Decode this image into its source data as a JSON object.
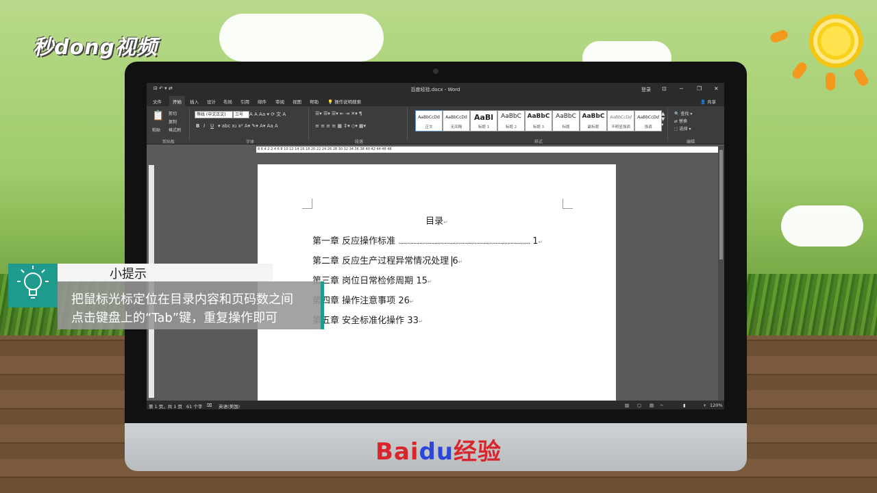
{
  "watermark": "秒dong视频",
  "brand": {
    "prefix": "Bai",
    "paw": "du",
    "suffix": "经验"
  },
  "word": {
    "quick_access": "⊟ ↶ ▾ ⇄",
    "doc_title": "百度经验.docx - Word",
    "login": "登录",
    "share": "共享",
    "tabs": [
      "文件",
      "开始",
      "插入",
      "设计",
      "布局",
      "引用",
      "邮件",
      "审阅",
      "视图",
      "帮助"
    ],
    "active_tab": "开始",
    "tell_me": "操作说明搜索",
    "clipboard": {
      "paste": "粘贴",
      "cut": "剪切",
      "copy": "复制",
      "format_painter": "格式刷",
      "label": "剪贴板"
    },
    "font": {
      "name": "等线 (中文正文)",
      "size": "三号",
      "bold": "B",
      "italic": "I",
      "underline": "U",
      "label": "字体"
    },
    "paragraph": {
      "label": "段落"
    },
    "styles": [
      {
        "preview": "AaBbCcDd",
        "name": "正文"
      },
      {
        "preview": "AaBbCcDd",
        "name": "无间隔"
      },
      {
        "preview": "AaBl",
        "name": "标题 1"
      },
      {
        "preview": "AaBbC",
        "name": "标题 2"
      },
      {
        "preview": "AaBbC",
        "name": "标题 3"
      },
      {
        "preview": "AaBbC",
        "name": "标题"
      },
      {
        "preview": "AaBbC",
        "name": "副标题"
      },
      {
        "preview": "AaBbCcDd",
        "name": "不明显强调"
      },
      {
        "preview": "AaBbCcDd",
        "name": "强调"
      }
    ],
    "styles_label": "样式",
    "editing": {
      "find": "查找",
      "replace": "替换",
      "select": "选择",
      "label": "编辑"
    },
    "ruler_ticks": "8  6  4  2     2  4  6  8  10  12  14  16  18  20  22  24  26  28  30  32  34  36  38  40  42  44  46  48",
    "status": {
      "page": "第 1 页，共 1 页",
      "words": "61 个字",
      "language": "英语(美国)",
      "zoom": "120%"
    }
  },
  "document": {
    "title": "目录",
    "toc": [
      {
        "chapter": "第一章",
        "text": "反应操作标准",
        "leader": "........................................................................................",
        "page": "1"
      },
      {
        "chapter": "第二章",
        "text": "反应生产过程异常情况处理",
        "page": "6"
      },
      {
        "chapter": "第三章",
        "text": "岗位日常检修周期",
        "page": "15"
      },
      {
        "chapter": "第四章",
        "text": "操作注意事项",
        "page": "26"
      },
      {
        "chapter": "第五章",
        "text": "安全标准化操作",
        "page": "33"
      }
    ]
  },
  "tip": {
    "title": "小提示",
    "line1": "把鼠标光标定位在目录内容和页码数之间",
    "line2": "点击键盘上的“Tab”键，重复操作即可"
  }
}
